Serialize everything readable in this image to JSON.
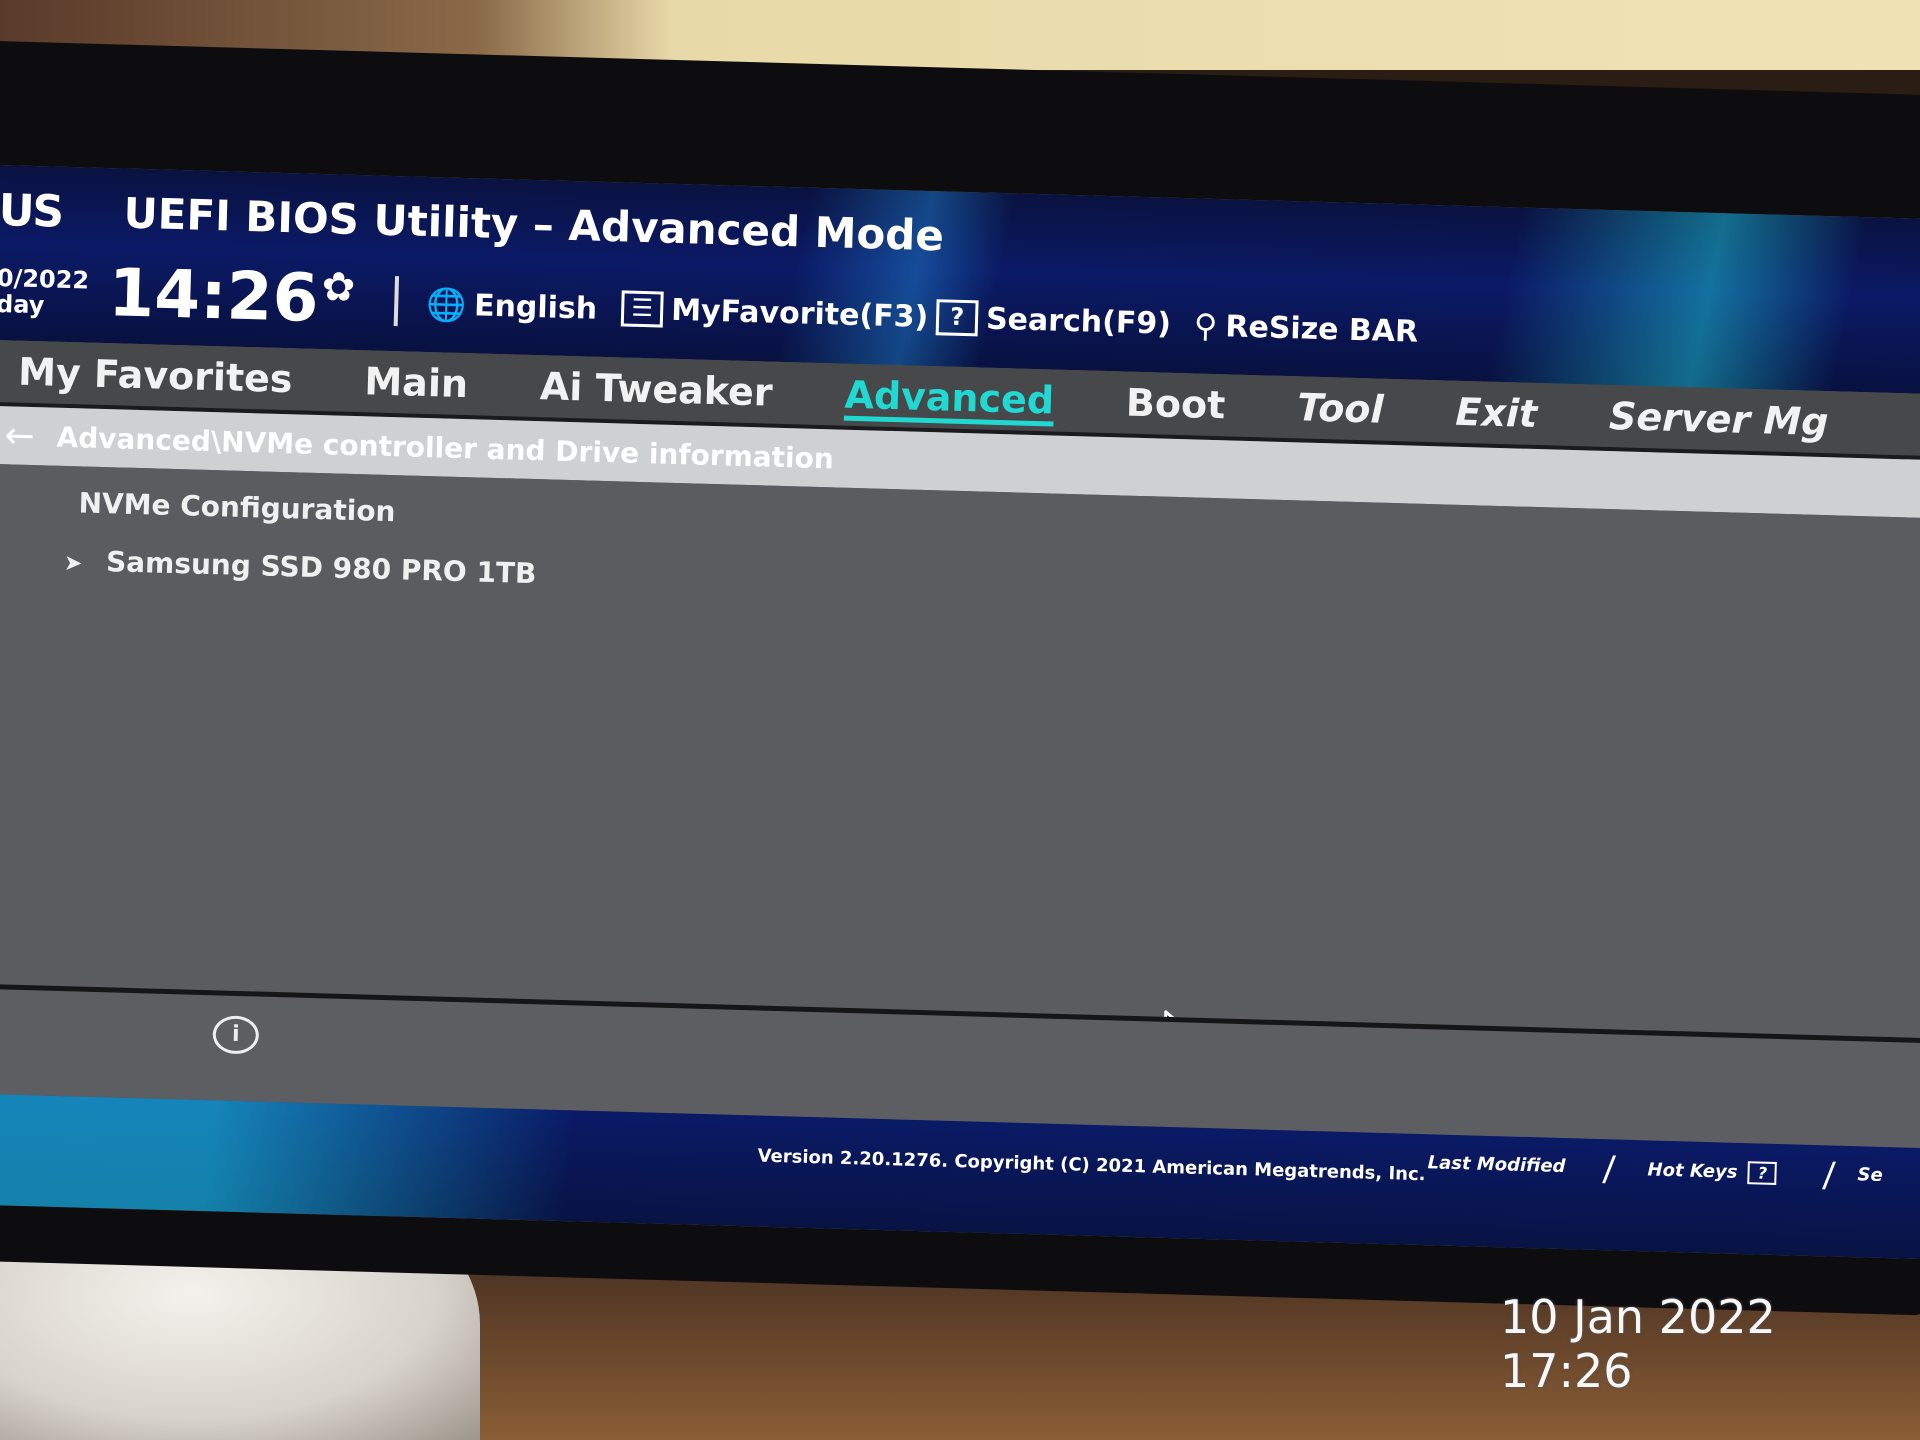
{
  "header": {
    "logo": "US",
    "title": "UEFI BIOS Utility – Advanced Mode",
    "date_line1": "0/2022",
    "date_line2": "day",
    "time": "14:26",
    "toolbar": [
      {
        "icon": "globe-icon",
        "glyph": "🌐",
        "label": "English"
      },
      {
        "icon": "favorites-icon",
        "glyph": "☰",
        "label": "MyFavorite(F3)"
      },
      {
        "icon": "help-icon",
        "glyph": "?",
        "label": "Search(F9)"
      },
      {
        "icon": "resize-bar-icon",
        "glyph": "⚲",
        "label": "ReSize BAR"
      }
    ]
  },
  "nav": {
    "tabs": [
      {
        "label": "My Favorites",
        "active": false
      },
      {
        "label": "Main",
        "active": false
      },
      {
        "label": "Ai Tweaker",
        "active": false
      },
      {
        "label": "Advanced",
        "active": true
      },
      {
        "label": "Boot",
        "active": false
      },
      {
        "label": "Tool",
        "active": false
      },
      {
        "label": "Exit",
        "active": false
      },
      {
        "label": "Server Mg",
        "active": false
      }
    ],
    "accent_color": "#21d9d3"
  },
  "breadcrumb": {
    "back_glyph": "←",
    "path": "Advanced\\NVMe controller and Drive information"
  },
  "content": {
    "section_label": "NVMe Configuration",
    "items": [
      {
        "arrow": "➤",
        "label": "Samsung SSD 980 PRO 1TB"
      }
    ]
  },
  "help": {
    "info_glyph": "i"
  },
  "footer": {
    "version": "Version 2.20.1276. Copyright (C) 2021 American Megatrends, Inc.",
    "last_modified": "Last Modified",
    "hot_keys": "Hot Keys",
    "hot_keys_box": "?",
    "truncated_item": "Se"
  },
  "photo_timestamp": "10 Jan 2022 17:26"
}
